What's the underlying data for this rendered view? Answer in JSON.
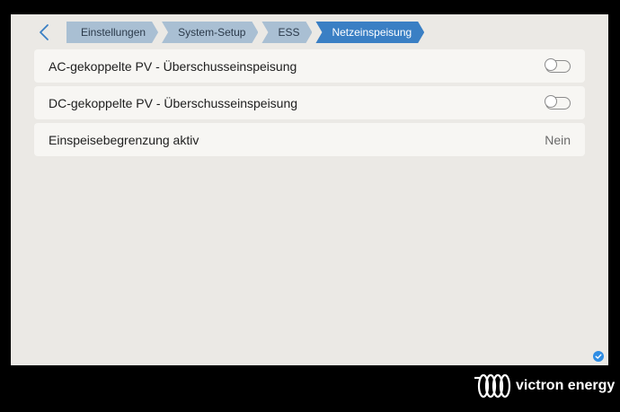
{
  "breadcrumb": [
    {
      "label": "Einstellungen"
    },
    {
      "label": "System-Setup"
    },
    {
      "label": "ESS"
    },
    {
      "label": "Netzeinspeisung"
    }
  ],
  "rows": [
    {
      "label": "AC-gekoppelte PV - Überschusseinspeisung",
      "control": "toggle",
      "on": false
    },
    {
      "label": "DC-gekoppelte PV - Überschusseinspeisung",
      "control": "toggle",
      "on": false
    },
    {
      "label": "Einspeisebegrenzung aktiv",
      "control": "value",
      "value": "Nein"
    }
  ],
  "colors": {
    "accent": "#3a7fc4",
    "crumb_inactive": "#a9bfd3",
    "background": "#ebe9e5",
    "row_background": "#f7f6f3"
  },
  "icons": {
    "back": "chevron-left-icon",
    "status": "check-circle-icon",
    "logo": "victron-logo-icon"
  },
  "logo": {
    "text": "victron energy"
  }
}
